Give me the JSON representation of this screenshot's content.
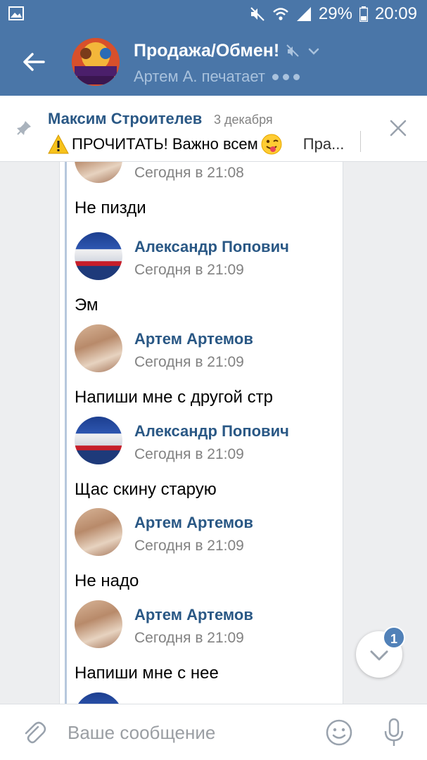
{
  "status_bar": {
    "battery": "29%",
    "time": "20:09",
    "icons": [
      "image-icon",
      "mute-icon",
      "wifi-icon",
      "signal-icon",
      "battery-icon"
    ]
  },
  "header": {
    "title": "Продажа/Обмен!",
    "subtitle": "Артем А. печатает",
    "avatar_text": "АККАУНТЫ ПРОДАЖА",
    "icons": [
      "back-arrow-icon",
      "muted-icon",
      "chevron-down-icon"
    ]
  },
  "pinned": {
    "author": "Максим Строителев",
    "date": "3 декабря",
    "text": "ПРОЧИТАТЬ! Важно всем",
    "more": "Пра..."
  },
  "messages": [
    {
      "author": "",
      "time": "Сегодня в 21:08",
      "text": "Не пизди",
      "avatar": "artem"
    },
    {
      "author": "Александр Попович",
      "time": "Сегодня в 21:09",
      "text": "Эм",
      "avatar": "alex"
    },
    {
      "author": "Артем Артемов",
      "time": "Сегодня в 21:09",
      "text": "Напиши мне с другой стр",
      "avatar": "artem"
    },
    {
      "author": "Александр Попович",
      "time": "Сегодня в 21:09",
      "text": "Щас скину старую",
      "avatar": "alex"
    },
    {
      "author": "Артем Артемов",
      "time": "Сегодня в 21:09",
      "text": "Не надо",
      "avatar": "artem"
    },
    {
      "author": "Артем Артемов",
      "time": "Сегодня в 21:09",
      "text": "Напиши мне с нее",
      "avatar": "artem"
    },
    {
      "author": "",
      "time": "",
      "text": "",
      "avatar": "alex"
    }
  ],
  "scroll_badge": "1",
  "composer": {
    "placeholder": "Ваше сообщение"
  },
  "colors": {
    "header": "#4a76a8",
    "link": "#2a5885",
    "badge": "#5181b8"
  }
}
